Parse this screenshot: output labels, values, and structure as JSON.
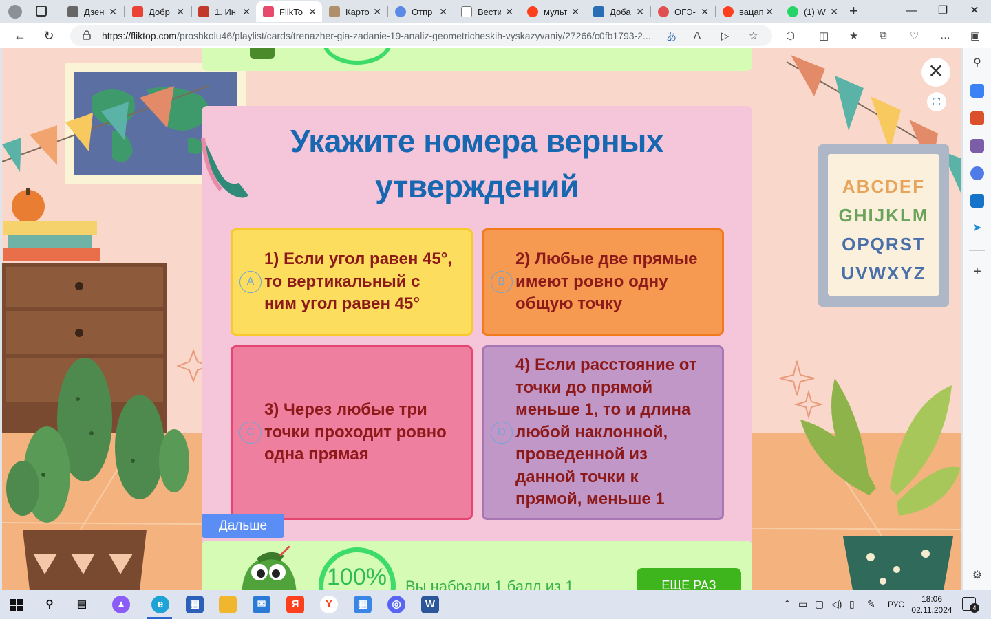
{
  "browser": {
    "tabs": [
      {
        "title": "Дзен",
        "icon": "dzen-icon",
        "color": "#555555"
      },
      {
        "title": "Добр",
        "icon": "gmail-icon",
        "color": "#ea4335"
      },
      {
        "title": "1. Ин",
        "icon": "doc-icon",
        "color": "#c0392b"
      },
      {
        "title": "FlikTo",
        "icon": "fliktop-icon",
        "color": "#e84a6b",
        "active": true
      },
      {
        "title": "Карто",
        "icon": "cards-icon",
        "color": "#b0906c"
      },
      {
        "title": "Отпр",
        "icon": "mail-icon",
        "color": "#5b8ae6"
      },
      {
        "title": "Вести",
        "icon": "page-icon",
        "color": "#888888"
      },
      {
        "title": "мульт",
        "icon": "yandex-icon",
        "color": "#fc3f1d"
      },
      {
        "title": "Доба",
        "icon": "book-icon",
        "color": "#2a6fb6"
      },
      {
        "title": "ОГЭ-",
        "icon": "oge-icon",
        "color": "#e05050"
      },
      {
        "title": "вацап",
        "icon": "yandex-icon",
        "color": "#fc3f1d"
      },
      {
        "title": "(1) W",
        "icon": "whatsapp-icon",
        "color": "#25d366"
      }
    ],
    "url_host": "https://fliktop.com",
    "url_path": "/proshkolu46/playlist/cards/trenazher-gia-zadanie-19-analiz-geometricheskih-vyskazyvaniy/27266/c0fb1793-2..."
  },
  "quiz": {
    "question": "Укажите номера верных утверждений",
    "answers": [
      {
        "letter": "A",
        "text": "1) Если угол равен 45°, то вертикальный с ним угол равен 45°",
        "bg": "#fcdd5e",
        "border": "#f7c92c"
      },
      {
        "letter": "B",
        "text": "2) Любые две прямые имеют ровно одну общую точку",
        "bg": "#f59a50",
        "border": "#f07a1c"
      },
      {
        "letter": "C",
        "text": "3) Через любые три точки проходит ровно одна прямая",
        "bg": "#ef7f9e",
        "border": "#e44571"
      },
      {
        "letter": "D",
        "text": "4) Если расстояние от точки до прямой меньше 1, то и длина любой наклонной, проведенной из данной точки к прямой, меньше 1",
        "bg": "#c197c8",
        "border": "#a777b4"
      }
    ],
    "next_label": "Дальше",
    "score_percent": "100%",
    "score_text": "Вы набрали 1 балл из 1",
    "again_label": "ЕЩЕ РАЗ"
  },
  "poster_letters": [
    "ABCDEF",
    "GHIJKLM",
    "OPQRST",
    "UVWXYZ"
  ],
  "taskbar": {
    "lang": "РУС",
    "time": "18:06",
    "date": "02.11.2024",
    "notifications": "4"
  }
}
